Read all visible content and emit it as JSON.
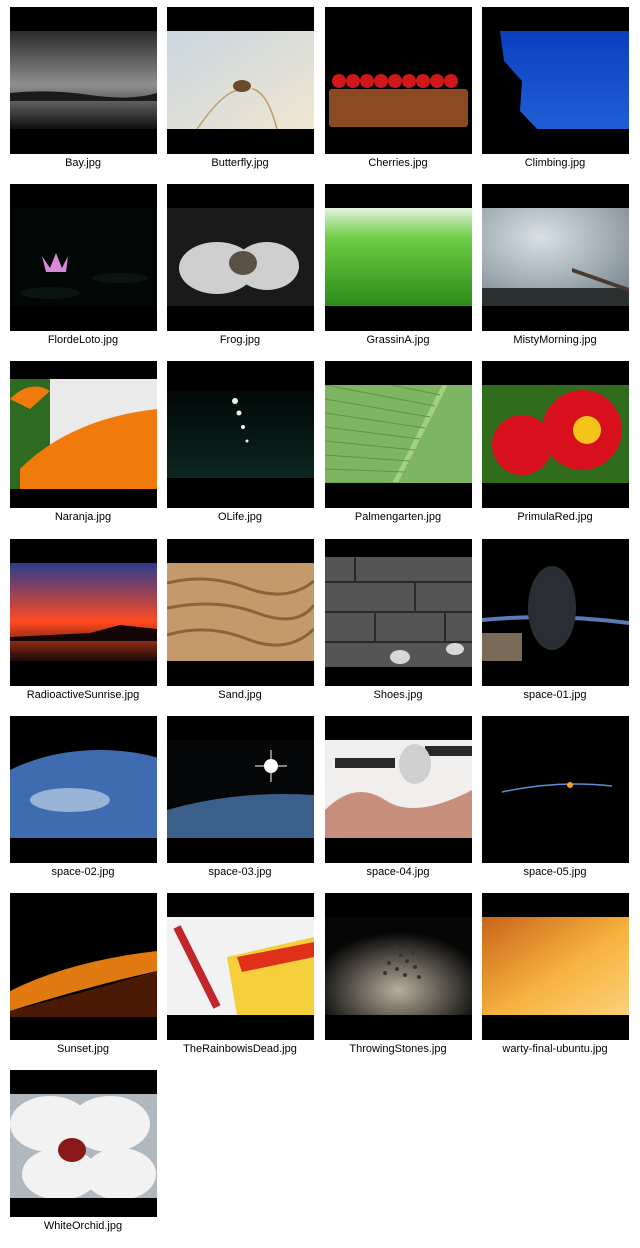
{
  "gallery": {
    "files": [
      {
        "name": "Bay.jpg",
        "icon": "thumbnail-icon",
        "colors": [
          "#2a2a2a",
          "#8f8f8f",
          "#0e0e0e"
        ]
      },
      {
        "name": "Butterfly.jpg",
        "icon": "thumbnail-icon",
        "colors": [
          "#c9d6e0",
          "#e8dfcc",
          "#f0e6d0"
        ]
      },
      {
        "name": "Cherries.jpg",
        "icon": "thumbnail-icon",
        "colors": [
          "#000000",
          "#d01818",
          "#8a4a22"
        ]
      },
      {
        "name": "Climbing.jpg",
        "icon": "thumbnail-icon",
        "colors": [
          "#1f5fd6",
          "#0a3fbf",
          "#000000"
        ]
      },
      {
        "name": "FlordeLoto.jpg",
        "icon": "thumbnail-icon",
        "colors": [
          "#020604",
          "#0b1510",
          "#d78ad8"
        ]
      },
      {
        "name": "Frog.jpg",
        "icon": "thumbnail-icon",
        "colors": [
          "#1a1a1a",
          "#cfcfcf",
          "#5a5046"
        ]
      },
      {
        "name": "GrassinA.jpg",
        "icon": "thumbnail-icon",
        "colors": [
          "#e4f3e0",
          "#6fcd45",
          "#2b8c18"
        ]
      },
      {
        "name": "MistyMorning.jpg",
        "icon": "thumbnail-icon",
        "colors": [
          "#d8e0e6",
          "#7b8890",
          "#2a2f2f"
        ]
      },
      {
        "name": "Naranja.jpg",
        "icon": "thumbnail-icon",
        "colors": [
          "#eaeaea",
          "#f07a0c",
          "#2e6a1f"
        ]
      },
      {
        "name": "OLife.jpg",
        "icon": "thumbnail-icon",
        "colors": [
          "#020807",
          "#0b2620",
          "#e6f3ef"
        ]
      },
      {
        "name": "Palmengarten.jpg",
        "icon": "thumbnail-icon",
        "colors": [
          "#7db562",
          "#5a9944",
          "#a4d07f"
        ]
      },
      {
        "name": "PrimulaRed.jpg",
        "icon": "thumbnail-icon",
        "colors": [
          "#d8101e",
          "#f4c41a",
          "#2f6d1d"
        ]
      },
      {
        "name": "RadioactiveSunrise.jpg",
        "icon": "thumbnail-icon",
        "colors": [
          "#2a3c8e",
          "#ff4a1f",
          "#1a0a0a"
        ]
      },
      {
        "name": "Sand.jpg",
        "icon": "thumbnail-icon",
        "colors": [
          "#c49a6a",
          "#8e6238",
          "#e1bf8d"
        ]
      },
      {
        "name": "Shoes.jpg",
        "icon": "thumbnail-icon",
        "colors": [
          "#555555",
          "#2a2a2a",
          "#d8d8d8"
        ]
      },
      {
        "name": "space-01.jpg",
        "icon": "thumbnail-icon",
        "colors": [
          "#000000",
          "#5d7bb5",
          "#7a6a58"
        ]
      },
      {
        "name": "space-02.jpg",
        "icon": "thumbnail-icon",
        "colors": [
          "#000000",
          "#3f6cb0",
          "#d6e4f2"
        ]
      },
      {
        "name": "space-03.jpg",
        "icon": "thumbnail-icon",
        "colors": [
          "#040608",
          "#3a5f8a",
          "#ffffff"
        ]
      },
      {
        "name": "space-04.jpg",
        "icon": "thumbnail-icon",
        "colors": [
          "#c98f7d",
          "#f1eeee",
          "#2a2a2a"
        ]
      },
      {
        "name": "space-05.jpg",
        "icon": "thumbnail-icon",
        "colors": [
          "#000000",
          "#5d8ed8",
          "#ff9a2a"
        ]
      },
      {
        "name": "Sunset.jpg",
        "icon": "thumbnail-icon",
        "colors": [
          "#000000",
          "#e07a10",
          "#4a1a05"
        ]
      },
      {
        "name": "TheRainbowisDead.jpg",
        "icon": "thumbnail-icon",
        "colors": [
          "#f2f2f2",
          "#e0301a",
          "#f5d03a"
        ]
      },
      {
        "name": "ThrowingStones.jpg",
        "icon": "thumbnail-icon",
        "colors": [
          "#050505",
          "#b9ae9c",
          "#3a342c"
        ]
      },
      {
        "name": "warty-final-ubuntu.jpg",
        "icon": "thumbnail-icon",
        "colors": [
          "#f6b23e",
          "#c9631a",
          "#fad27a"
        ]
      },
      {
        "name": "WhiteOrchid.jpg",
        "icon": "thumbnail-icon",
        "colors": [
          "#f2f2f2",
          "#8a1a1a",
          "#b0b8bf"
        ]
      }
    ]
  }
}
